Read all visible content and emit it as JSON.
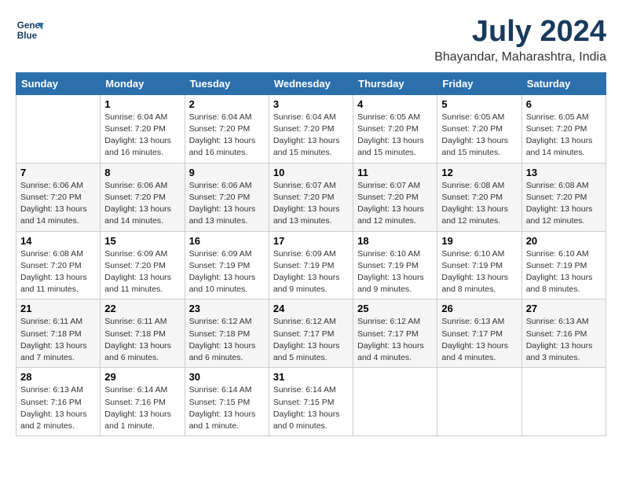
{
  "header": {
    "logo_line1": "General",
    "logo_line2": "Blue",
    "month_title": "July 2024",
    "location": "Bhayandar, Maharashtra, India"
  },
  "weekdays": [
    "Sunday",
    "Monday",
    "Tuesday",
    "Wednesday",
    "Thursday",
    "Friday",
    "Saturday"
  ],
  "weeks": [
    [
      {
        "day": "",
        "info": ""
      },
      {
        "day": "1",
        "info": "Sunrise: 6:04 AM\nSunset: 7:20 PM\nDaylight: 13 hours\nand 16 minutes."
      },
      {
        "day": "2",
        "info": "Sunrise: 6:04 AM\nSunset: 7:20 PM\nDaylight: 13 hours\nand 16 minutes."
      },
      {
        "day": "3",
        "info": "Sunrise: 6:04 AM\nSunset: 7:20 PM\nDaylight: 13 hours\nand 15 minutes."
      },
      {
        "day": "4",
        "info": "Sunrise: 6:05 AM\nSunset: 7:20 PM\nDaylight: 13 hours\nand 15 minutes."
      },
      {
        "day": "5",
        "info": "Sunrise: 6:05 AM\nSunset: 7:20 PM\nDaylight: 13 hours\nand 15 minutes."
      },
      {
        "day": "6",
        "info": "Sunrise: 6:05 AM\nSunset: 7:20 PM\nDaylight: 13 hours\nand 14 minutes."
      }
    ],
    [
      {
        "day": "7",
        "info": "Sunrise: 6:06 AM\nSunset: 7:20 PM\nDaylight: 13 hours\nand 14 minutes."
      },
      {
        "day": "8",
        "info": "Sunrise: 6:06 AM\nSunset: 7:20 PM\nDaylight: 13 hours\nand 14 minutes."
      },
      {
        "day": "9",
        "info": "Sunrise: 6:06 AM\nSunset: 7:20 PM\nDaylight: 13 hours\nand 13 minutes."
      },
      {
        "day": "10",
        "info": "Sunrise: 6:07 AM\nSunset: 7:20 PM\nDaylight: 13 hours\nand 13 minutes."
      },
      {
        "day": "11",
        "info": "Sunrise: 6:07 AM\nSunset: 7:20 PM\nDaylight: 13 hours\nand 12 minutes."
      },
      {
        "day": "12",
        "info": "Sunrise: 6:08 AM\nSunset: 7:20 PM\nDaylight: 13 hours\nand 12 minutes."
      },
      {
        "day": "13",
        "info": "Sunrise: 6:08 AM\nSunset: 7:20 PM\nDaylight: 13 hours\nand 12 minutes."
      }
    ],
    [
      {
        "day": "14",
        "info": "Sunrise: 6:08 AM\nSunset: 7:20 PM\nDaylight: 13 hours\nand 11 minutes."
      },
      {
        "day": "15",
        "info": "Sunrise: 6:09 AM\nSunset: 7:20 PM\nDaylight: 13 hours\nand 11 minutes."
      },
      {
        "day": "16",
        "info": "Sunrise: 6:09 AM\nSunset: 7:19 PM\nDaylight: 13 hours\nand 10 minutes."
      },
      {
        "day": "17",
        "info": "Sunrise: 6:09 AM\nSunset: 7:19 PM\nDaylight: 13 hours\nand 9 minutes."
      },
      {
        "day": "18",
        "info": "Sunrise: 6:10 AM\nSunset: 7:19 PM\nDaylight: 13 hours\nand 9 minutes."
      },
      {
        "day": "19",
        "info": "Sunrise: 6:10 AM\nSunset: 7:19 PM\nDaylight: 13 hours\nand 8 minutes."
      },
      {
        "day": "20",
        "info": "Sunrise: 6:10 AM\nSunset: 7:19 PM\nDaylight: 13 hours\nand 8 minutes."
      }
    ],
    [
      {
        "day": "21",
        "info": "Sunrise: 6:11 AM\nSunset: 7:18 PM\nDaylight: 13 hours\nand 7 minutes."
      },
      {
        "day": "22",
        "info": "Sunrise: 6:11 AM\nSunset: 7:18 PM\nDaylight: 13 hours\nand 6 minutes."
      },
      {
        "day": "23",
        "info": "Sunrise: 6:12 AM\nSunset: 7:18 PM\nDaylight: 13 hours\nand 6 minutes."
      },
      {
        "day": "24",
        "info": "Sunrise: 6:12 AM\nSunset: 7:17 PM\nDaylight: 13 hours\nand 5 minutes."
      },
      {
        "day": "25",
        "info": "Sunrise: 6:12 AM\nSunset: 7:17 PM\nDaylight: 13 hours\nand 4 minutes."
      },
      {
        "day": "26",
        "info": "Sunrise: 6:13 AM\nSunset: 7:17 PM\nDaylight: 13 hours\nand 4 minutes."
      },
      {
        "day": "27",
        "info": "Sunrise: 6:13 AM\nSunset: 7:16 PM\nDaylight: 13 hours\nand 3 minutes."
      }
    ],
    [
      {
        "day": "28",
        "info": "Sunrise: 6:13 AM\nSunset: 7:16 PM\nDaylight: 13 hours\nand 2 minutes."
      },
      {
        "day": "29",
        "info": "Sunrise: 6:14 AM\nSunset: 7:16 PM\nDaylight: 13 hours\nand 1 minute."
      },
      {
        "day": "30",
        "info": "Sunrise: 6:14 AM\nSunset: 7:15 PM\nDaylight: 13 hours\nand 1 minute."
      },
      {
        "day": "31",
        "info": "Sunrise: 6:14 AM\nSunset: 7:15 PM\nDaylight: 13 hours\nand 0 minutes."
      },
      {
        "day": "",
        "info": ""
      },
      {
        "day": "",
        "info": ""
      },
      {
        "day": "",
        "info": ""
      }
    ]
  ]
}
